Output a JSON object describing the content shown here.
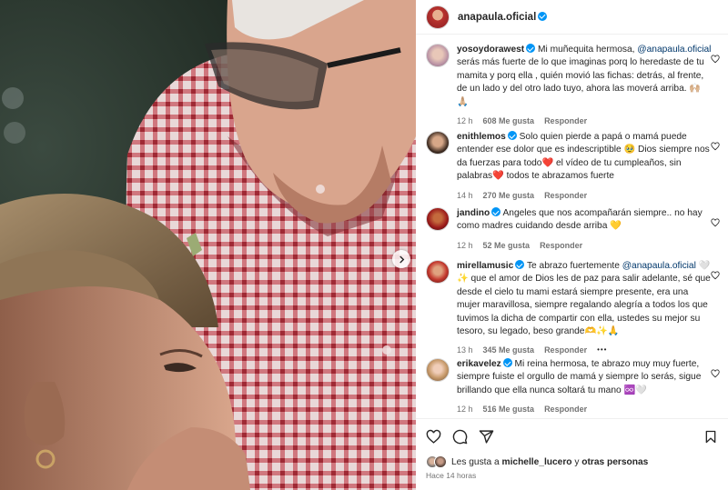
{
  "post": {
    "author": "anapaula.oficial",
    "author_verified": true
  },
  "media": {
    "next_icon": "chevron-right-icon"
  },
  "comments": [
    {
      "username": "yosoydorawest",
      "verified": true,
      "text_before": " Mi muñequita hermosa, ",
      "mention": "@anapaula.oficial",
      "text_after": " serás más fuerte de lo que imaginas porq lo heredaste de tu mamita y porq ella , quién movió las fichas: detrás, al frente, de un lado y del otro lado tuyo, ahora las moverá arriba. 🙌🏼 🙏🏼",
      "time": "12 h",
      "likes": "608 Me gusta",
      "reply": "Responder"
    },
    {
      "username": "enithlemos",
      "verified": true,
      "text_before": " Solo quien pierde a papá o mamá puede entender ese dolor que es indescriptible 🥹 Dios siempre nos da fuerzas para todo❤️ el vídeo de tu cumpleaños, sin palabras❤️ todos te abrazamos fuerte",
      "mention": "",
      "text_after": "",
      "time": "14 h",
      "likes": "270 Me gusta",
      "reply": "Responder"
    },
    {
      "username": "jandino",
      "verified": true,
      "text_before": " Angeles que nos acompañarán siempre.. no hay como madres cuidando desde arriba 💛",
      "mention": "",
      "text_after": "",
      "time": "12 h",
      "likes": "52 Me gusta",
      "reply": "Responder"
    },
    {
      "username": "mirellamusic",
      "verified": true,
      "text_before": " Te abrazo fuertemente ",
      "mention": "@anapaula.oficial",
      "text_after": " 🤍✨ que el amor de Dios les de paz para salir adelante, sé que desde el cielo tu mami estará siempre presente, era una mujer maravillosa, siempre regalando alegría a todos los que tuvimos la dicha de compartir con ella, ustedes su mejor su tesoro, su legado, beso grande🫶✨🙏",
      "time": "13 h",
      "likes": "345 Me gusta",
      "reply": "Responder",
      "more": "•••"
    },
    {
      "username": "erikavelez",
      "verified": true,
      "text_before": " Mi reina hermosa, te abrazo muy muy fuerte, siempre fuiste el orgullo de mamá y siempre lo serás, sigue brillando que ella nunca soltará tu mano ♾️🤍",
      "mention": "",
      "text_after": "",
      "time": "12 h",
      "likes": "516 Me gusta",
      "reply": "Responder"
    }
  ],
  "actions": {
    "like_icon": "heart-icon",
    "comment_icon": "comment-icon",
    "share_icon": "share-icon",
    "save_icon": "bookmark-icon"
  },
  "likes_summary": {
    "prefix": "Les gusta a ",
    "user": "michelle_lucero",
    "middle": " y ",
    "others": "otras personas"
  },
  "posted_time": "Hace 14 horas",
  "colors": {
    "verified": "#0095f6",
    "mention": "#00376b",
    "secondary_text": "#737373"
  }
}
